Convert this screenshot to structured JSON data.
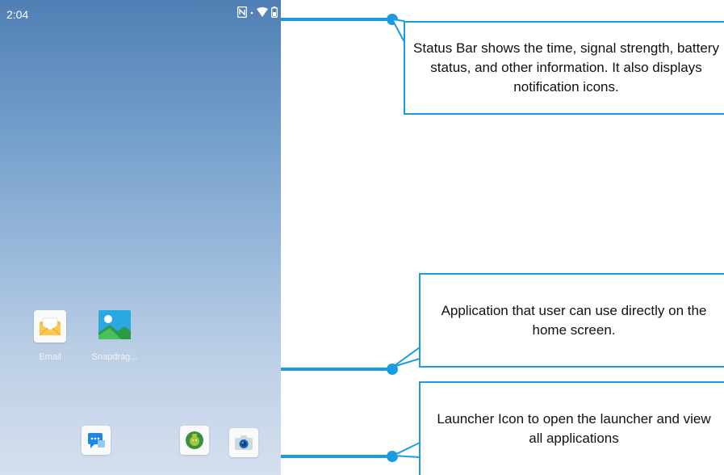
{
  "status_bar": {
    "time": "2:04",
    "icons": [
      "nfc-icon",
      "wifi-icon",
      "battery-icon"
    ]
  },
  "apps": [
    {
      "label": "Email",
      "icon": "email-icon"
    },
    {
      "label": "Snapdrag...",
      "icon": "gallery-icon"
    }
  ],
  "dock": [
    {
      "icon": "messages-icon"
    },
    {
      "icon": "launcher-icon"
    },
    {
      "icon": "camera-icon"
    }
  ],
  "callouts": {
    "status_bar": "Status Bar shows the time, signal strength, battery status, and other information. It also displays notification icons.",
    "applications": "Application that user can use directly on the home screen.",
    "launcher": "Launcher Icon to open the launcher and view all applications"
  },
  "colors": {
    "accent": "#1c9ce0",
    "wallpaper_top": "#4f7fb4",
    "wallpaper_bottom": "#d5e0ee"
  }
}
